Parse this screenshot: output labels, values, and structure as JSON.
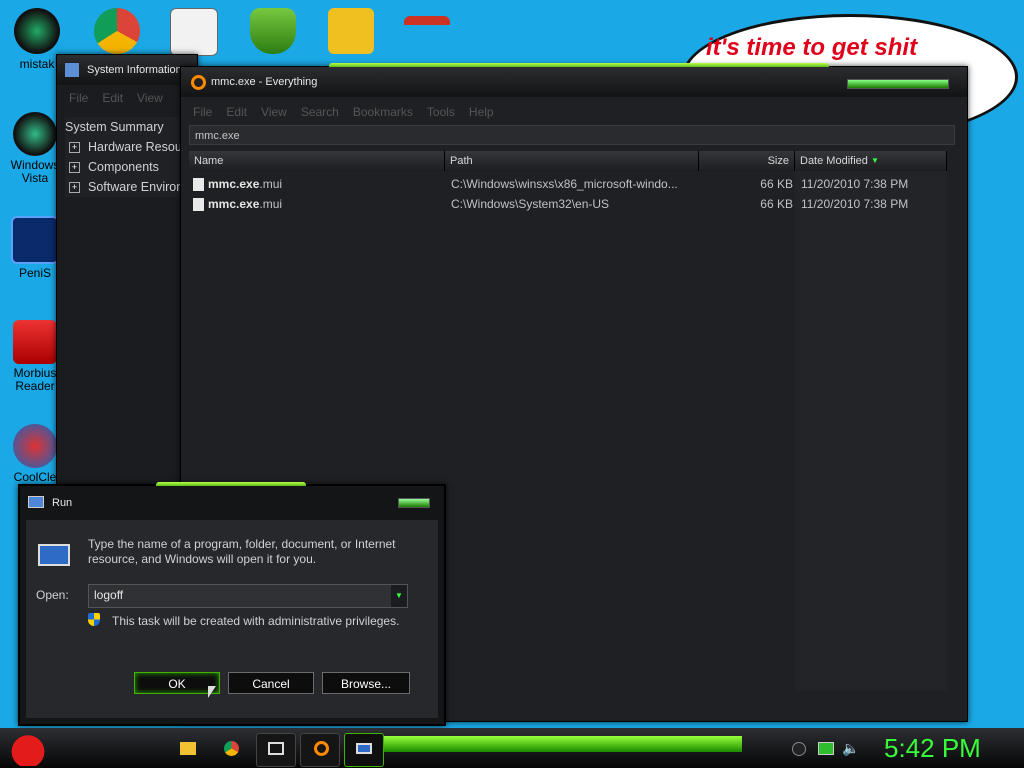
{
  "desktop": {
    "icons": [
      {
        "label": "mistak"
      },
      {
        "label": "Windows Vista"
      },
      {
        "label": "PeniS"
      },
      {
        "label": "Morbius Reader"
      },
      {
        "label": "CoolCle"
      }
    ],
    "bubble_text": "it's time to get shit"
  },
  "sysinfo": {
    "title": "System Information",
    "menu": [
      "File",
      "Edit",
      "View"
    ],
    "tree": {
      "root": "System Summary",
      "children": [
        "Hardware Resources",
        "Components",
        "Software Environment"
      ]
    }
  },
  "everything": {
    "title": "mmc.exe - Everything",
    "menu": [
      "File",
      "Edit",
      "View",
      "Search",
      "Bookmarks",
      "Tools",
      "Help"
    ],
    "search_value": "mmc.exe",
    "columns": {
      "name": "Name",
      "path": "Path",
      "size": "Size",
      "date": "Date Modified"
    },
    "rows": [
      {
        "name_bold": "mmc.exe",
        "name_rest": ".mui",
        "path": "C:\\Windows\\winsxs\\x86_microsoft-windo...",
        "size": "66 KB",
        "date": "11/20/2010 7:38 PM"
      },
      {
        "name_bold": "mmc.exe",
        "name_rest": ".mui",
        "path": "C:\\Windows\\System32\\en-US",
        "size": "66 KB",
        "date": "11/20/2010 7:38 PM"
      }
    ]
  },
  "run": {
    "title": "Run",
    "description": "Type the name of a program, folder, document, or Internet resource, and Windows will open it for you.",
    "open_label": "Open:",
    "open_value": "logoff",
    "admin_note": "This task will be created with administrative privileges.",
    "ok_label": "OK",
    "cancel_label": "Cancel",
    "browse_label": "Browse..."
  },
  "taskbar": {
    "clock": "5:42 PM"
  },
  "colors": {
    "accent_green": "#39ff3a",
    "desktop_bg": "#1aa9e6"
  }
}
